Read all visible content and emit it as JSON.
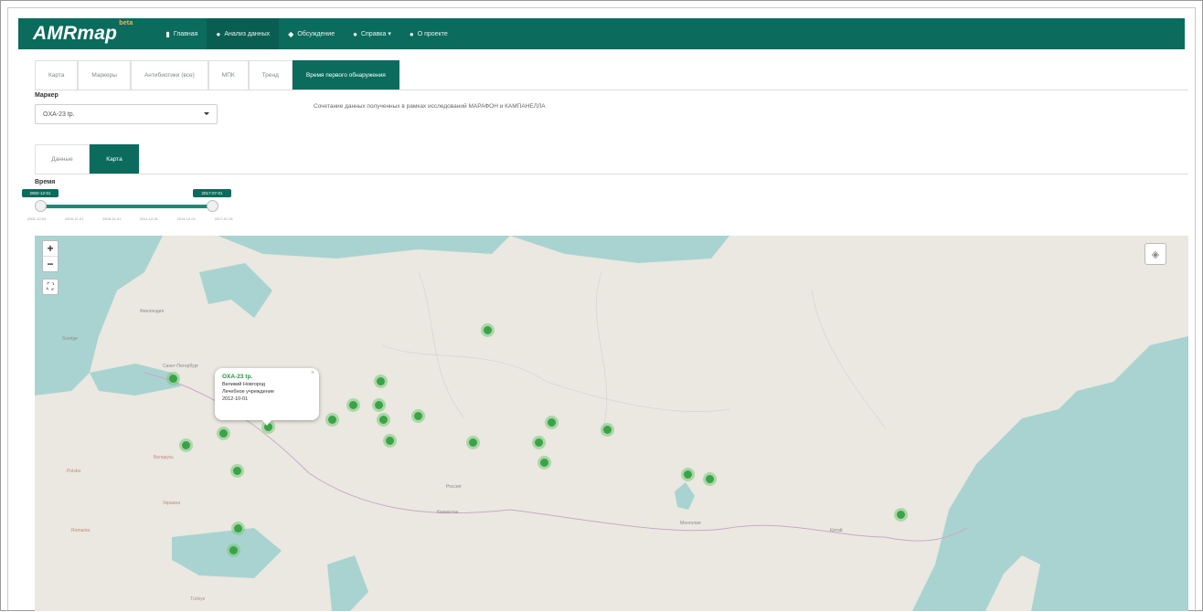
{
  "app": {
    "brand": "AMRmap",
    "brand_sup": "beta"
  },
  "navbar": {
    "items": [
      {
        "label": "Главная",
        "icon": "home-icon",
        "glyph": "▮"
      },
      {
        "label": "Анализ данных",
        "icon": "chart-icon",
        "glyph": "●"
      },
      {
        "label": "Обсуждение",
        "icon": "comments-icon",
        "glyph": "◆"
      },
      {
        "label": "Справка ▾",
        "icon": "info-icon",
        "glyph": "●"
      },
      {
        "label": "О проекте",
        "icon": "info-circle-icon",
        "glyph": "●"
      }
    ]
  },
  "tabs": [
    {
      "label": "Карта"
    },
    {
      "label": "Маркеры"
    },
    {
      "label": "Антибиотики (все)"
    },
    {
      "label": "МПК"
    },
    {
      "label": "Тренд"
    },
    {
      "label": "Время первого обнаружения"
    }
  ],
  "marker_panel": {
    "label": "Маркер",
    "selected": "OXA-23 tp.",
    "info": "Сочетание данных полученных в рамках исследований МАРАФОН и КАМПАНЕЛЛА"
  },
  "subtabs": [
    {
      "label": "Данные"
    },
    {
      "label": "Карта"
    }
  ],
  "time": {
    "label": "Время",
    "from": "2002-12-01",
    "to": "2017-07-01",
    "ticks": [
      "2002-12-01",
      "2005-12-01",
      "2008-12-01",
      "2011-12-01",
      "2014-12-01",
      "2017-07-01"
    ]
  },
  "map": {
    "zoom_in": "+",
    "zoom_out": "−",
    "fullscreen_glyph": "⛶",
    "layers_glyph": "◈",
    "labels": [
      {
        "text": "Финляндия",
        "cls": "",
        "pos": "l1"
      },
      {
        "text": "Sverige",
        "cls": "",
        "pos": "l2"
      },
      {
        "text": "Санкт-Петербург",
        "cls": "",
        "pos": "l3"
      },
      {
        "text": "Беларусь",
        "cls": "red",
        "pos": "l4"
      },
      {
        "text": "Украина",
        "cls": "red",
        "pos": "l5"
      },
      {
        "text": "Казахстан",
        "cls": "",
        "pos": "l6"
      },
      {
        "text": "Россия",
        "cls": "",
        "pos": "l7"
      },
      {
        "text": "Монголия",
        "cls": "",
        "pos": "l8"
      },
      {
        "text": "Китай",
        "cls": "",
        "pos": "l9"
      },
      {
        "text": "Polska",
        "cls": "red",
        "pos": "l10"
      },
      {
        "text": "Romania",
        "cls": "red",
        "pos": "l11"
      },
      {
        "text": "Türkiye",
        "cls": "red",
        "pos": "l12"
      }
    ],
    "popup": {
      "title": "OXA-23 tp.",
      "line1": "Великий Новгород",
      "line2": "Лечебное учреждение",
      "date": "2012-10-01",
      "close": "×"
    }
  },
  "colors": {
    "nav": "#0b6b5d",
    "accent": "#ffb24a",
    "marker": "#3aa34a",
    "water": "#a9d3d1",
    "land": "#eae8e0"
  }
}
